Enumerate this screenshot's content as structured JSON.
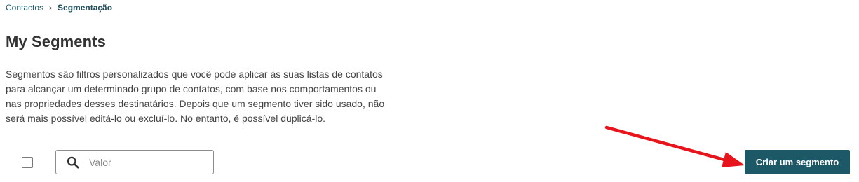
{
  "breadcrumb": {
    "parent": "Contactos",
    "separator": "›",
    "current": "Segmentação"
  },
  "page": {
    "title": "My Segments",
    "description": "Segmentos são filtros personalizados que você pode aplicar às suas listas de contatos para alcançar um determinado grupo de contatos, com base nos comportamentos ou nas propriedades desses destinatários. Depois que um segmento tiver sido usado, não será mais possível editá-lo ou excluí-lo. No entanto, é possível duplicá-lo."
  },
  "toolbar": {
    "search": {
      "placeholder": "Valor",
      "value": "",
      "icon": "search-icon"
    },
    "create_button_label": "Criar um segmento"
  },
  "annotation": {
    "arrow_color": "#e8141c"
  },
  "colors": {
    "primary_button": "#1d5866",
    "link": "#1f5a6b"
  }
}
